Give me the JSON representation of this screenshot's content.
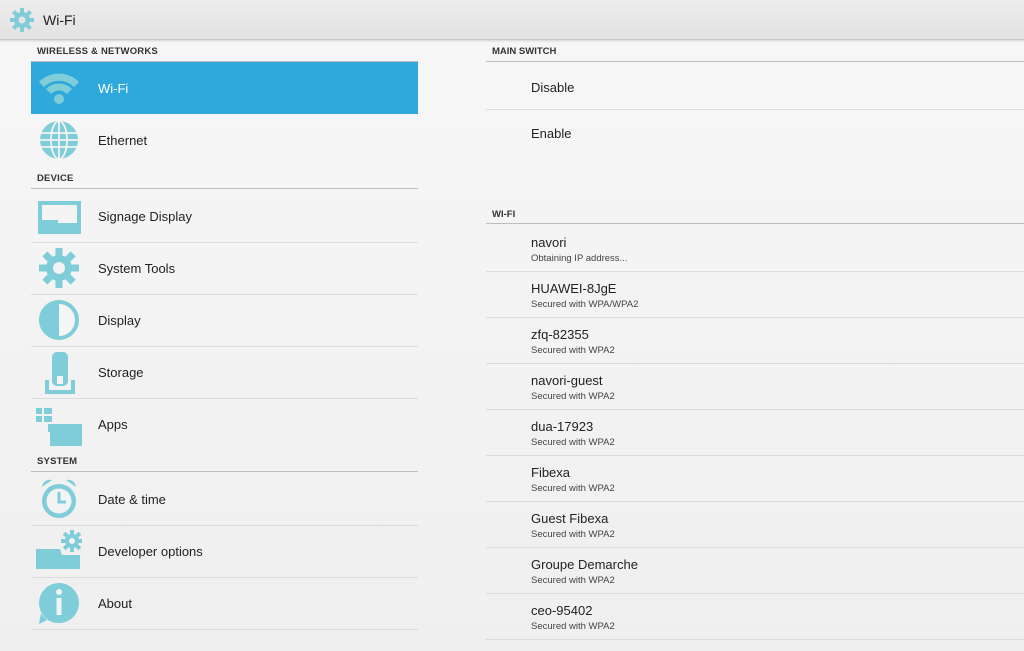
{
  "window": {
    "title": "Wi-Fi"
  },
  "colors": {
    "accent": "#2fa9dc",
    "icon": "#7fcdd8"
  },
  "left": {
    "sections": [
      {
        "header": "WIRELESS & NETWORKS"
      },
      {
        "header": "DEVICE"
      },
      {
        "header": "SYSTEM"
      }
    ],
    "items": [
      {
        "label": "Wi-Fi",
        "icon": "wifi-icon",
        "selected": true
      },
      {
        "label": "Ethernet",
        "icon": "globe-icon"
      },
      {
        "label": "Signage Display",
        "icon": "display-cast-icon"
      },
      {
        "label": "System Tools",
        "icon": "gear-icon"
      },
      {
        "label": "Display",
        "icon": "brightness-icon"
      },
      {
        "label": "Storage",
        "icon": "storage-icon"
      },
      {
        "label": "Apps",
        "icon": "apps-icon"
      },
      {
        "label": "Date & time",
        "icon": "alarm-clock-icon"
      },
      {
        "label": "Developer options",
        "icon": "developer-gear-icon"
      },
      {
        "label": "About",
        "icon": "info-icon"
      }
    ]
  },
  "right": {
    "main_switch": {
      "header": "MAIN SWITCH",
      "options": [
        "Disable",
        "Enable"
      ]
    },
    "wifi": {
      "header": "WI-FI",
      "networks": [
        {
          "ssid": "navori",
          "status": "Obtaining IP address..."
        },
        {
          "ssid": "HUAWEI-8JgE",
          "status": "Secured with WPA/WPA2"
        },
        {
          "ssid": "zfq-82355",
          "status": "Secured with WPA2"
        },
        {
          "ssid": "navori-guest",
          "status": "Secured with WPA2"
        },
        {
          "ssid": "dua-17923",
          "status": "Secured with WPA2"
        },
        {
          "ssid": "Fibexa",
          "status": "Secured with WPA2"
        },
        {
          "ssid": "Guest Fibexa",
          "status": "Secured with WPA2"
        },
        {
          "ssid": "Groupe Demarche",
          "status": "Secured with WPA2"
        },
        {
          "ssid": "ceo-95402",
          "status": "Secured with WPA2"
        }
      ]
    }
  }
}
